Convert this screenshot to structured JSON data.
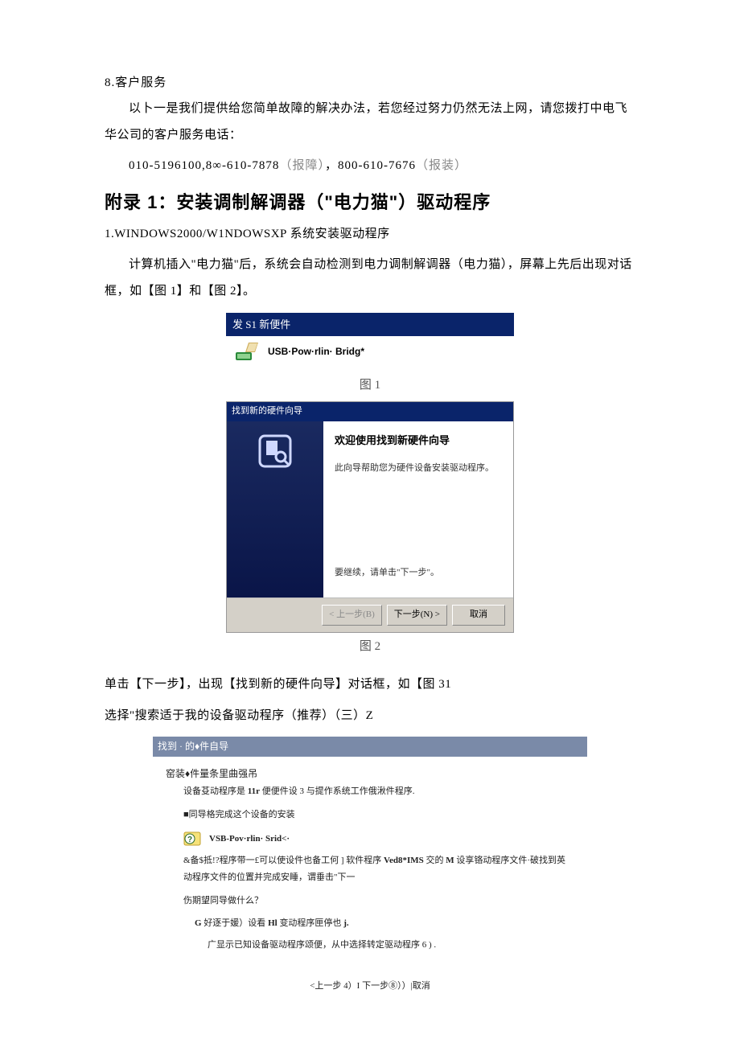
{
  "section8": {
    "num": "8.客户服务",
    "p1": "以卜一是我们提供给您简单故障的解决办法，若您经过努力仍然无法上网，请您拨打中电飞华公司的客户服务电话：",
    "phone_a": "010-5196100,8∞-610-7878",
    "phone_a_note": "（报障）",
    "phone_b": "，800-610-7676",
    "phone_b_note": "（报装）"
  },
  "appendix": {
    "title": "附录 1：安装调制解调器（\"电力猫\"）驱动程序",
    "sub1": "1.WINDOWS2000/W1NDOWSXP 系统安装驱动程序",
    "p1": "计算机插入\"电力猫\"后，系统会自动检测到电力调制解调器（电力猫），屏幕上先后出现对话框，如【图 1】和【图 2】。"
  },
  "dlg1": {
    "title": "发 S1 新便件",
    "device": "USB·Pow·rlin· Bridg*"
  },
  "fig1": "图 1",
  "dlg2": {
    "title": "找到新的硬件向导",
    "heading": "欢迎使用找到新硬件向导",
    "desc": "此向导帮助您为硬件设备安装驱动程序。",
    "cont": "要继续，请单击\"下一步\"。",
    "btn_back": "< 上一步(B)",
    "btn_next": "下一步(N) >",
    "btn_cancel": "取消"
  },
  "fig2": "图 2",
  "after2": {
    "p1": "单击【下一步】，出现【找到新的硬件向导】对话框，如【图 31",
    "p2": "选择\"搜索适于我的设备驱动程序（推荐）（三）Z"
  },
  "dlg3": {
    "title": "找到 · 的♦件自导",
    "line1": "窑装♦件量条里曲强吊",
    "line2_a": "设备芟动程序是 ",
    "line2_b": "11r",
    "line2_c": " 便便件设 3 与提作系统工作俄湫件程序.",
    "line3": "■同导格完成这个设备的安装",
    "device": "VSB-Pov·rlin· Srid<·",
    "line4_a": "&备$抵!?程序带一£可以使设件也备工何 ] 软件程序 ",
    "line4_b": "Ved8*IMS",
    "line4_c": " 交的 ",
    "line4_d": "M",
    "line4_e": " 设享铬动程序文件·破找到英动程序文件的位置并完成安睡，谓垂击\"下一",
    "line5": "伤期望同导做什么？",
    "line6_a": "G",
    "line6_b": " 好逐于媛）设看 ",
    "line6_c": "Hl",
    "line6_d": " 变动程序匣停也 ",
    "line6_e": "j.",
    "line7": "广显示已知设备驱动程序颂便，从中选择转定驱动程序 6 ) .",
    "btns": "<上一步 4）I 下一步⑧））|取消"
  }
}
